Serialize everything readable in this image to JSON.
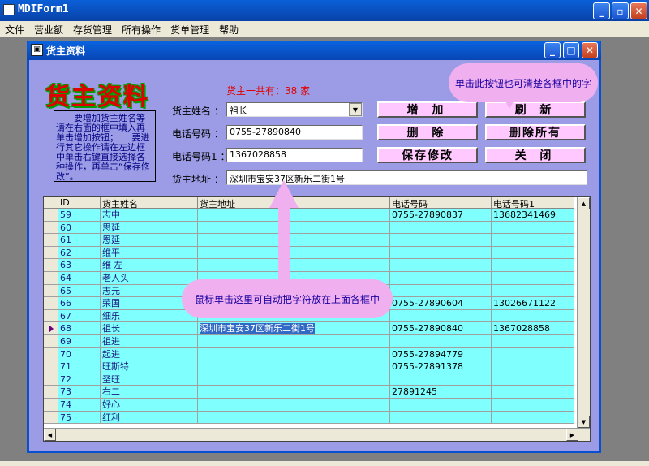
{
  "mdi": {
    "title": "MDIForm1",
    "min": "_",
    "max": "▫",
    "close": "✕"
  },
  "menu": [
    "文件",
    "营业额",
    "存货管理",
    "所有操作",
    "货单管理",
    "帮助"
  ],
  "child": {
    "title": "货主资料",
    "min": "_",
    "max": "□",
    "close": "✕"
  },
  "form": {
    "big_title": "货主资料",
    "help_text": "　　要增加货主姓名等请在右面的框中填入再单击增加按钮；　　要进行其它操作请在左边框中单击右键直接选择各种操作，再单击“保存修改”。",
    "count_label": "货主一共有：38 家",
    "name_label": "货主姓名 ：",
    "name_value": "祖长",
    "phone_label": "电话号码 ：",
    "phone_value": "0755-27890840",
    "phone1_label": "电话号码1 ：",
    "phone1_value": "1367028858",
    "address_label": "货主地址 ：",
    "address_value": "深圳市宝安37区新乐二街1号"
  },
  "buttons": {
    "add": "增 加",
    "refresh": "刷 新",
    "delete": "删 除",
    "delete_all": "删除所有",
    "save": "保存修改",
    "close": "关 闭"
  },
  "callouts": {
    "top": "单击此按钮也可清楚各框中的字",
    "middle": "鼠标单击这里可自动把字符放在上面各框中"
  },
  "table": {
    "headers": [
      "ID",
      "货主姓名",
      "货主地址",
      "电话号码",
      "电话号码1"
    ],
    "rows": [
      [
        "59",
        "志中",
        "",
        "0755-27890837",
        "13682341469"
      ],
      [
        "60",
        "思延",
        "",
        "",
        ""
      ],
      [
        "61",
        "恩延",
        "",
        "",
        ""
      ],
      [
        "62",
        "维平",
        "",
        "",
        ""
      ],
      [
        "63",
        "维  左",
        "",
        "",
        ""
      ],
      [
        "64",
        "老人头",
        "",
        "",
        ""
      ],
      [
        "65",
        "志元",
        "",
        "",
        ""
      ],
      [
        "66",
        "荣国",
        "",
        "0755-27890604",
        "13026671122"
      ],
      [
        "67",
        "细乐",
        "",
        "",
        ""
      ],
      [
        "68",
        "祖长",
        "深圳市宝安37区新乐二街1号",
        "0755-27890840",
        "1367028858"
      ],
      [
        "69",
        "祖进",
        "",
        "",
        ""
      ],
      [
        "70",
        "起进",
        "",
        "0755-27894779",
        ""
      ],
      [
        "71",
        "旺斯特",
        "",
        "0755-27891378",
        ""
      ],
      [
        "72",
        "圣旺",
        "",
        "",
        ""
      ],
      [
        "73",
        "右二",
        "",
        "27891245",
        ""
      ],
      [
        "74",
        "好心",
        "",
        "",
        ""
      ],
      [
        "75",
        "红利",
        "",
        "",
        ""
      ]
    ],
    "selected_row_index": 9
  },
  "colors": {
    "grid_cell": "#80ffff",
    "button_face": "#ffc8ff",
    "form_bg": "#9c9ce6",
    "callout": "#f0b0f0"
  }
}
